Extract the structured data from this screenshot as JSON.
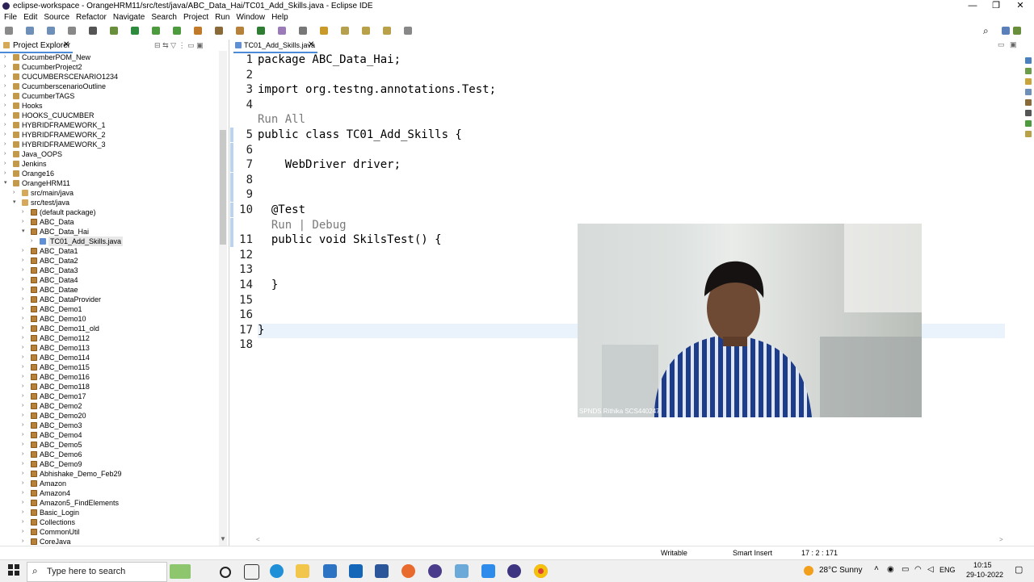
{
  "window": {
    "title": "eclipse-workspace - OrangeHRM11/src/test/java/ABC_Data_Hai/TC01_Add_Skills.java - Eclipse IDE",
    "controls": [
      "—",
      "❐",
      "✕"
    ]
  },
  "menu": [
    "File",
    "Edit",
    "Source",
    "Refactor",
    "Navigate",
    "Search",
    "Project",
    "Run",
    "Window",
    "Help"
  ],
  "project_explorer": {
    "tab_label": "Project Explorer",
    "items": [
      {
        "label": "CucumberPOM_New",
        "depth": 0,
        "kind": "project",
        "expanded": false
      },
      {
        "label": "CucumberProject2",
        "depth": 0,
        "kind": "project",
        "expanded": false
      },
      {
        "label": "CUCUMBERSCENARIO1234",
        "depth": 0,
        "kind": "project",
        "expanded": false
      },
      {
        "label": "CucumberscenarioOutline",
        "depth": 0,
        "kind": "project",
        "expanded": false
      },
      {
        "label": "CucumberTAGS",
        "depth": 0,
        "kind": "project",
        "expanded": false
      },
      {
        "label": "Hooks",
        "depth": 0,
        "kind": "project",
        "expanded": false
      },
      {
        "label": "HOOKS_CUUCMBER",
        "depth": 0,
        "kind": "project",
        "expanded": false
      },
      {
        "label": "HYBRIDFRAMEWORK_1",
        "depth": 0,
        "kind": "project",
        "expanded": false
      },
      {
        "label": "HYBRIDFRAMEWORK_2",
        "depth": 0,
        "kind": "project",
        "expanded": false
      },
      {
        "label": "HYBRIDFRAMEWORK_3",
        "depth": 0,
        "kind": "project",
        "expanded": false
      },
      {
        "label": "Java_OOPS",
        "depth": 0,
        "kind": "project",
        "expanded": false
      },
      {
        "label": "Jenkins",
        "depth": 0,
        "kind": "project",
        "expanded": false
      },
      {
        "label": "Orange16",
        "depth": 0,
        "kind": "project",
        "expanded": false
      },
      {
        "label": "OrangeHRM11",
        "depth": 0,
        "kind": "project",
        "expanded": true
      },
      {
        "label": "src/main/java",
        "depth": 1,
        "kind": "src",
        "expanded": false
      },
      {
        "label": "src/test/java",
        "depth": 1,
        "kind": "src",
        "expanded": true
      },
      {
        "label": "(default package)",
        "depth": 2,
        "kind": "package",
        "expanded": false
      },
      {
        "label": "ABC_Data",
        "depth": 2,
        "kind": "package",
        "expanded": false
      },
      {
        "label": "ABC_Data_Hai",
        "depth": 2,
        "kind": "package",
        "expanded": true
      },
      {
        "label": "TC01_Add_Skills.java",
        "depth": 3,
        "kind": "file",
        "expanded": false
      },
      {
        "label": "ABC_Data1",
        "depth": 2,
        "kind": "package",
        "expanded": false
      },
      {
        "label": "ABC_Data2",
        "depth": 2,
        "kind": "package",
        "expanded": false
      },
      {
        "label": "ABC_Data3",
        "depth": 2,
        "kind": "package",
        "expanded": false
      },
      {
        "label": "ABC_Data4",
        "depth": 2,
        "kind": "package",
        "expanded": false
      },
      {
        "label": "ABC_Datae",
        "depth": 2,
        "kind": "package",
        "expanded": false
      },
      {
        "label": "ABC_DataProvider",
        "depth": 2,
        "kind": "package",
        "expanded": false
      },
      {
        "label": "ABC_Demo1",
        "depth": 2,
        "kind": "package",
        "expanded": false
      },
      {
        "label": "ABC_Demo10",
        "depth": 2,
        "kind": "package",
        "expanded": false
      },
      {
        "label": "ABC_Demo11_old",
        "depth": 2,
        "kind": "package",
        "expanded": false
      },
      {
        "label": "ABC_Demo112",
        "depth": 2,
        "kind": "package",
        "expanded": false
      },
      {
        "label": "ABC_Demo113",
        "depth": 2,
        "kind": "package",
        "expanded": false
      },
      {
        "label": "ABC_Demo114",
        "depth": 2,
        "kind": "package",
        "expanded": false
      },
      {
        "label": "ABC_Demo115",
        "depth": 2,
        "kind": "package",
        "expanded": false
      },
      {
        "label": "ABC_Demo116",
        "depth": 2,
        "kind": "package",
        "expanded": false
      },
      {
        "label": "ABC_Demo118",
        "depth": 2,
        "kind": "package",
        "expanded": false
      },
      {
        "label": "ABC_Demo17",
        "depth": 2,
        "kind": "package",
        "expanded": false
      },
      {
        "label": "ABC_Demo2",
        "depth": 2,
        "kind": "package",
        "expanded": false
      },
      {
        "label": "ABC_Demo20",
        "depth": 2,
        "kind": "package",
        "expanded": false
      },
      {
        "label": "ABC_Demo3",
        "depth": 2,
        "kind": "package",
        "expanded": false
      },
      {
        "label": "ABC_Demo4",
        "depth": 2,
        "kind": "package",
        "expanded": false
      },
      {
        "label": "ABC_Demo5",
        "depth": 2,
        "kind": "package",
        "expanded": false
      },
      {
        "label": "ABC_Demo6",
        "depth": 2,
        "kind": "package",
        "expanded": false
      },
      {
        "label": "ABC_Demo9",
        "depth": 2,
        "kind": "package",
        "expanded": false
      },
      {
        "label": "Abhishake_Demo_Feb29",
        "depth": 2,
        "kind": "package",
        "expanded": false
      },
      {
        "label": "Amazon",
        "depth": 2,
        "kind": "package",
        "expanded": false
      },
      {
        "label": "Amazon4",
        "depth": 2,
        "kind": "package",
        "expanded": false
      },
      {
        "label": "Amazon5_FindElements",
        "depth": 2,
        "kind": "package",
        "expanded": false
      },
      {
        "label": "Basic_Login",
        "depth": 2,
        "kind": "package",
        "expanded": false
      },
      {
        "label": "Collections",
        "depth": 2,
        "kind": "package",
        "expanded": false
      },
      {
        "label": "CommonUtil",
        "depth": 2,
        "kind": "package",
        "expanded": false
      },
      {
        "label": "CoreJava",
        "depth": 2,
        "kind": "package",
        "expanded": false
      }
    ]
  },
  "editor": {
    "tab_label": "TC01_Add_Skills.java",
    "lines": [
      {
        "num": "1",
        "text": "package ABC_Data_Hai;",
        "lens": false
      },
      {
        "num": "2",
        "text": "",
        "lens": false
      },
      {
        "num": "3",
        "text": "import org.testng.annotations.Test;",
        "lens": false
      },
      {
        "num": "4",
        "text": "",
        "lens": false
      },
      {
        "num": "",
        "text": "Run All",
        "lens": true
      },
      {
        "num": "5",
        "text": "public class TC01_Add_Skills {",
        "lens": false
      },
      {
        "num": "6",
        "text": "",
        "lens": false
      },
      {
        "num": "7",
        "text": "    WebDriver driver;",
        "lens": false
      },
      {
        "num": "8",
        "text": "",
        "lens": false
      },
      {
        "num": "9",
        "text": "",
        "lens": false
      },
      {
        "num": "10",
        "text": "  @Test",
        "lens": false
      },
      {
        "num": "",
        "text": "  Run | Debug",
        "lens": true
      },
      {
        "num": "11",
        "text": "  public void SkilsTest() {",
        "lens": false
      },
      {
        "num": "12",
        "text": "",
        "lens": false
      },
      {
        "num": "13",
        "text": "",
        "lens": false
      },
      {
        "num": "14",
        "text": "  }",
        "lens": false
      },
      {
        "num": "15",
        "text": "",
        "lens": false
      },
      {
        "num": "16",
        "text": "",
        "lens": false
      },
      {
        "num": "17",
        "text": "}",
        "lens": false
      },
      {
        "num": "18",
        "text": "",
        "lens": false
      }
    ]
  },
  "webcam": {
    "caption": "SPNDS Rithika SCS440247"
  },
  "status": {
    "mode": "Writable",
    "insert": "Smart Insert",
    "position": "17 : 2 : 171"
  },
  "taskbar": {
    "search_placeholder": "Type here to search",
    "weather": "28°C  Sunny",
    "lang": "ENG",
    "time": "10:15",
    "date": "29-10-2022"
  }
}
